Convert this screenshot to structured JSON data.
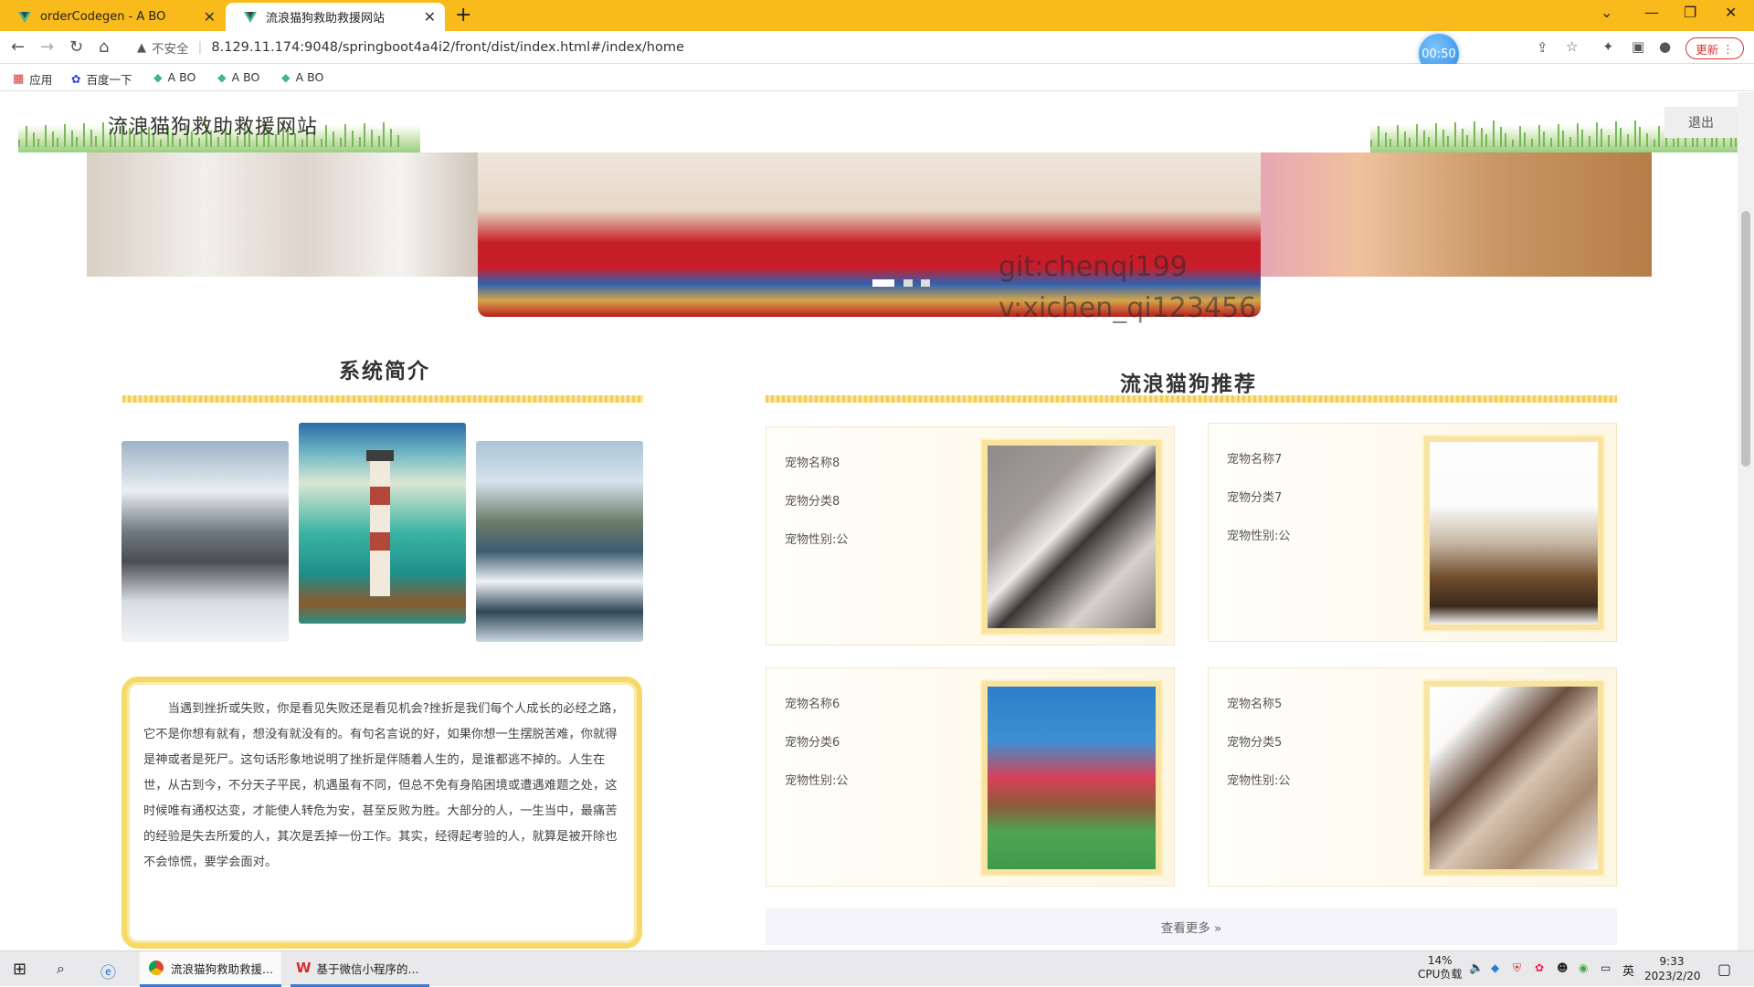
{
  "browser": {
    "tabs": [
      {
        "title": "orderCodegen - A BO",
        "active": false
      },
      {
        "title": "流浪猫狗救助救援网站",
        "active": true
      }
    ],
    "new_tab": "+",
    "security_label": "不安全",
    "url": "8.129.11.174:9048/springboot4a4i2/front/dist/index.html#/index/home",
    "timer": "00:50",
    "update_button": "更新",
    "bookmarks": [
      {
        "label": "应用",
        "icon": "apps-grid-icon"
      },
      {
        "label": "百度一下",
        "icon": "baidu-paw-icon"
      },
      {
        "label": "A BO",
        "icon": "vue-logo-icon"
      },
      {
        "label": "A BO",
        "icon": "vue-logo-icon"
      },
      {
        "label": "A BO",
        "icon": "vue-logo-icon"
      }
    ]
  },
  "header": {
    "site_title": "流浪猫狗救助救援网站",
    "logout_label": "退出"
  },
  "carousel": {
    "watermark_line1": "git:chenqi199",
    "watermark_line2": "v:xichen_qi123456",
    "slides": 3,
    "active_slide": 1
  },
  "intro": {
    "title": "系统简介",
    "text": "当遇到挫折或失败，你是看见失败还是看见机会?挫折是我们每个人成长的必经之路，它不是你想有就有，想没有就没有的。有句名言说的好，如果你想一生摆脱苦难，你就得是神或者是死尸。这句话形象地说明了挫折是伴随着人生的，是谁都逃不掉的。人生在世，从古到今，不分天子平民，机遇虽有不同，但总不免有身陷困境或遭遇难题之处，这时候唯有通权达变，才能使人转危为安，甚至反败为胜。大部分的人，一生当中，最痛苦的经验是失去所爱的人，其次是丢掉一份工作。其实，经得起考验的人，就算是被开除也不会惊慌，要学会面对。"
  },
  "recommend": {
    "title": "流浪猫狗推荐",
    "pets": [
      {
        "name": "宠物名称8",
        "category": "宠物分类8",
        "gender": "宠物性别:公",
        "photo": "gray-white-cat"
      },
      {
        "name": "宠物名称7",
        "category": "宠物分类7",
        "gender": "宠物性别:公",
        "photo": "cats-and-dogs-group"
      },
      {
        "name": "宠物名称6",
        "category": "宠物分类6",
        "gender": "宠物性别:公",
        "photo": "girl-with-spaniel"
      },
      {
        "name": "宠物名称5",
        "category": "宠物分类5",
        "gender": "宠物性别:公",
        "photo": "ragdoll-cat"
      }
    ],
    "more_label": "查看更多 »"
  },
  "taskbar": {
    "apps": [
      {
        "label": "流浪猫狗救助救援...",
        "icon": "chrome-icon"
      },
      {
        "label": "基于微信小程序的...",
        "icon": "wps-icon"
      }
    ],
    "cpu_percent": "14%",
    "cpu_label": "CPU负载",
    "ime": "英",
    "time": "9:33",
    "date": "2023/2/20"
  },
  "colors": {
    "tabbar": "#f9bb1b",
    "accent_yellow": "#f6d968",
    "text": "#333333"
  }
}
